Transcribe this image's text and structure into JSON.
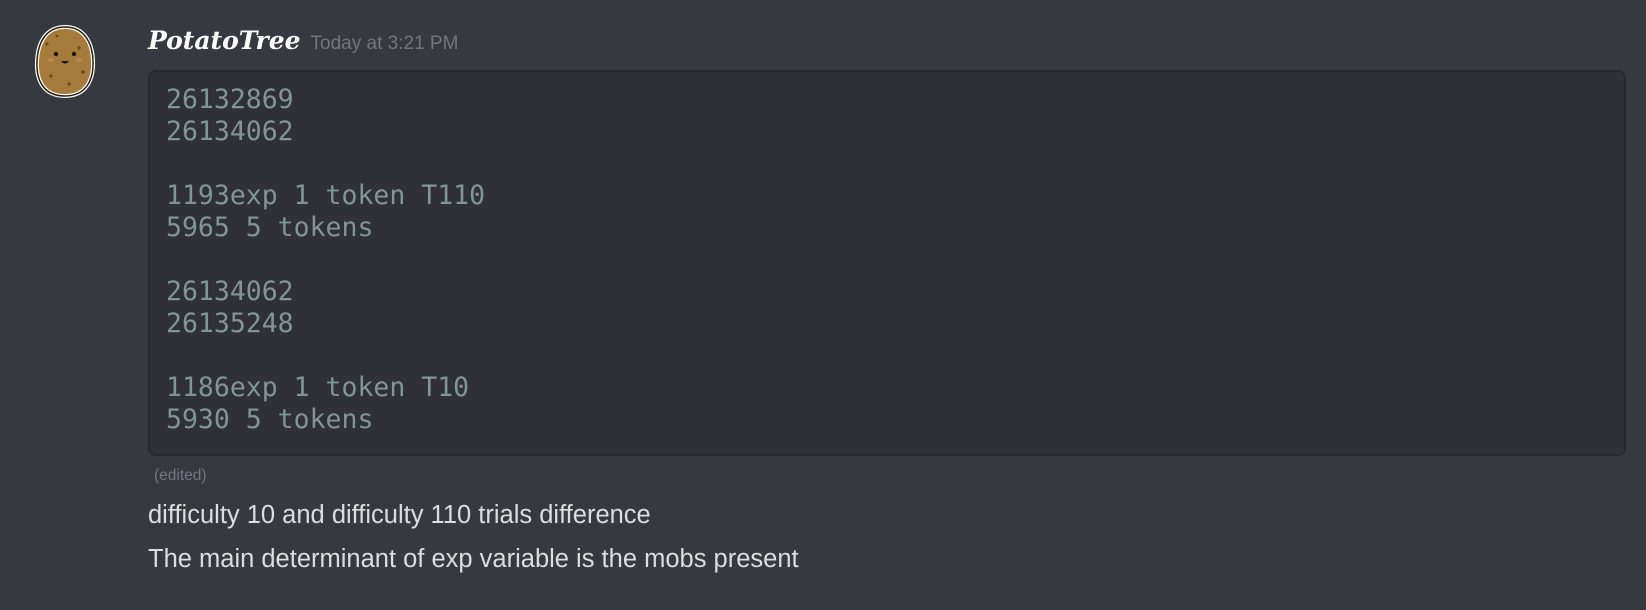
{
  "message": {
    "avatar_icon": "potato-icon",
    "username": "PotatoTree",
    "timestamp": "Today at 3:21 PM",
    "code_lines": [
      "26132869",
      "26134062",
      "",
      "1193exp 1 token T110",
      "5965 5 tokens",
      "",
      "26134062",
      "26135248",
      "",
      "1186exp 1 token T10",
      "5930 5 tokens"
    ],
    "edited_label": "(edited)",
    "text_lines": [
      "difficulty 10 and difficulty 110 trials difference",
      "The main determinant of exp variable is the mobs present"
    ]
  },
  "colors": {
    "background": "#36393f",
    "code_background": "#2f3136",
    "code_text": "#839496",
    "username": "#ffffff",
    "muted": "#72767d",
    "body_text": "#dcddde"
  }
}
